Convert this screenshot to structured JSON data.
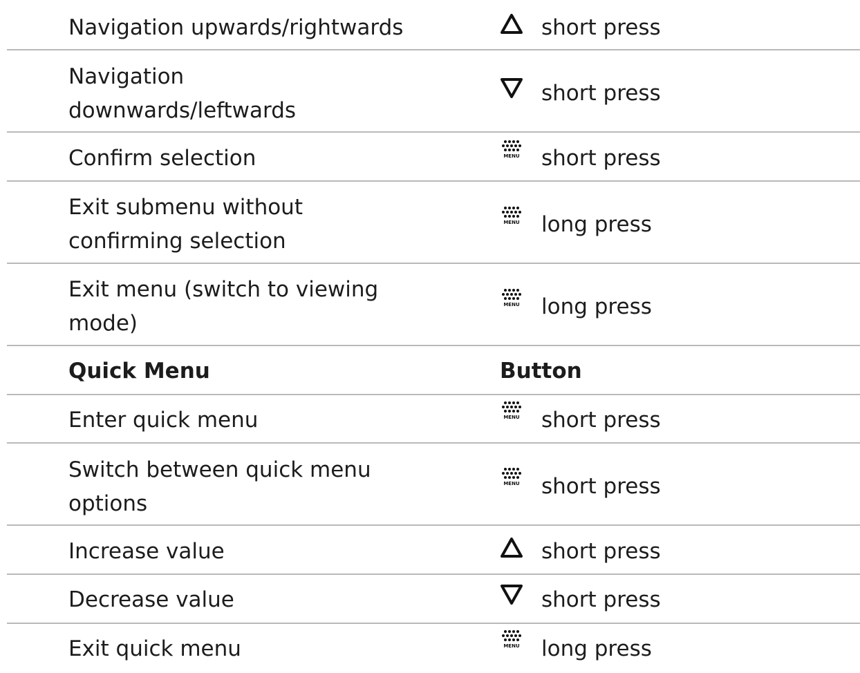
{
  "rows": [
    {
      "description": "Navigation upwards/rightwards",
      "icon": "up-triangle-icon",
      "action": "short press"
    },
    {
      "description": "Navigation downwards/leftwards",
      "icon": "down-triangle-icon",
      "action": "short press"
    },
    {
      "description": "Confirm selection",
      "icon": "menu-button-icon",
      "action": "short press"
    },
    {
      "description": "Exit submenu without confirming selection",
      "icon": "menu-button-icon",
      "action": "long press"
    },
    {
      "description": "Exit menu (switch to viewing mode)",
      "icon": "menu-button-icon",
      "action": "long press"
    },
    {
      "header": true,
      "description": "Quick Menu",
      "button": "Button"
    },
    {
      "description": "Enter quick menu",
      "icon": "menu-button-icon",
      "action": "short press"
    },
    {
      "description": "Switch between quick menu options",
      "icon": "menu-button-icon",
      "action": "short press"
    },
    {
      "description": "Increase value",
      "icon": "up-triangle-icon",
      "action": "short press"
    },
    {
      "description": "Decrease value",
      "icon": "down-triangle-icon",
      "action": "short press"
    },
    {
      "description": "Exit quick menu",
      "icon": "menu-button-icon",
      "action": "long press"
    }
  ],
  "menu_icon_label": "MENU"
}
